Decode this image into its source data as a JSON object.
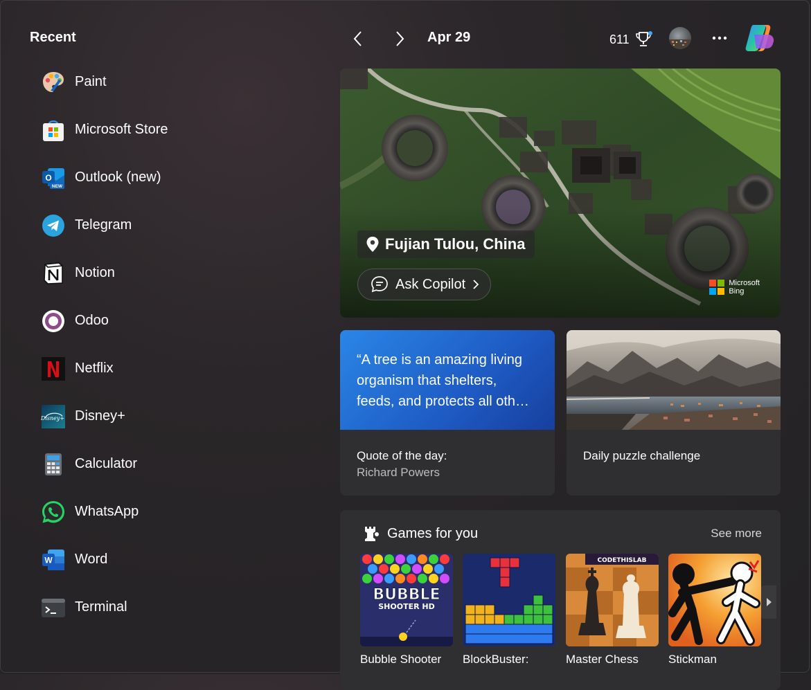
{
  "recent": {
    "title": "Recent",
    "items": [
      {
        "label": "Paint",
        "icon": "paint-icon"
      },
      {
        "label": "Microsoft Store",
        "icon": "microsoft-store-icon"
      },
      {
        "label": "Outlook (new)",
        "icon": "outlook-icon"
      },
      {
        "label": "Telegram",
        "icon": "telegram-icon"
      },
      {
        "label": "Notion",
        "icon": "notion-icon"
      },
      {
        "label": "Odoo",
        "icon": "odoo-icon"
      },
      {
        "label": "Netflix",
        "icon": "netflix-icon"
      },
      {
        "label": "Disney+",
        "icon": "disney-plus-icon"
      },
      {
        "label": "Calculator",
        "icon": "calculator-icon"
      },
      {
        "label": "WhatsApp",
        "icon": "whatsapp-icon"
      },
      {
        "label": "Word",
        "icon": "word-icon"
      },
      {
        "label": "Terminal",
        "icon": "terminal-icon"
      }
    ]
  },
  "header": {
    "date": "Apr 29",
    "points": "611"
  },
  "hero": {
    "location": "Fujian Tulou, China",
    "ask_copilot": "Ask Copilot",
    "bing_line1": "Microsoft",
    "bing_line2": "Bing"
  },
  "quote_card": {
    "quote": "“A tree is an amazing living organism that shelters, feeds, and protects all oth…",
    "title": "Quote of the day:",
    "author": "Richard Powers"
  },
  "puzzle_card": {
    "title": "Daily puzzle challenge"
  },
  "games": {
    "title": "Games for you",
    "see_more": "See more",
    "items": [
      {
        "name": "Bubble Shooter HD",
        "visible_name": "Bubble Shooter",
        "thumb_text1": "BUBBLE",
        "thumb_text2": "SHOOTER HD"
      },
      {
        "name": "BlockBuster: Adventure",
        "visible_name": "BlockBuster:"
      },
      {
        "name": "Master Chess",
        "visible_name": "Master Chess",
        "thumb_text1": "CODETHISLAB"
      },
      {
        "name": "Stickman Fighting",
        "visible_name": "Stickman"
      }
    ]
  },
  "colors": {
    "quote_gradient_start": "#2a86e6",
    "quote_gradient_end": "#173f9e",
    "card_bg": "#2f2f31"
  }
}
